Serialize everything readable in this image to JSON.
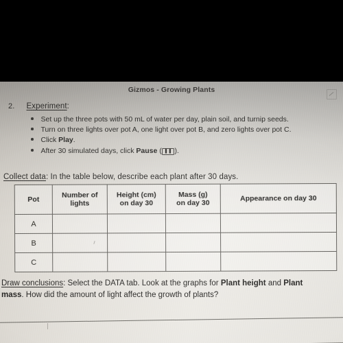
{
  "document": {
    "header_title": "Gizmos - Growing Plants",
    "header_icon": "edit-square-icon"
  },
  "section_experiment": {
    "number": "2.",
    "label": "Experiment",
    "colon": ":",
    "bullets": [
      {
        "text_before": "Set up the three pots with 50 mL of water per day, plain soil, and turnip seeds.",
        "bold": "",
        "text_after": ""
      },
      {
        "text_before": "Turn on three lights over pot A, one light over pot B, and zero lights over pot C.",
        "bold": "",
        "text_after": ""
      },
      {
        "text_before": "Click ",
        "bold": "Play",
        "text_after": "."
      },
      {
        "text_before": "After 30 simulated days, click ",
        "bold": "Pause",
        "text_after": ")."
      }
    ],
    "pause_paren_open": " (",
    "pause_icon_glyph": "❚❚",
    "pause_icon_name": "pause-icon"
  },
  "section_collect": {
    "number": "",
    "label": "Collect data",
    "rest": ": In the table below, describe each plant after 30 days."
  },
  "table": {
    "headers": [
      "Pot",
      "Number of\nlights",
      "Height (cm)\non day 30",
      "Mass (g)\non day 30",
      "Appearance on day 30"
    ],
    "header_lines": {
      "pot": "Pot",
      "lights_l1": "Number of",
      "lights_l2": "lights",
      "height_l1": "Height (cm)",
      "height_l2": "on day 30",
      "mass_l1": "Mass (g)",
      "mass_l2": "on day 30",
      "appearance": "Appearance on day 30"
    },
    "rows": [
      {
        "pot": "A",
        "lights": "",
        "height": "",
        "mass": "",
        "appearance": ""
      },
      {
        "pot": "B",
        "lights": "",
        "height": "",
        "mass": "",
        "appearance": ""
      },
      {
        "pot": "C",
        "lights": "",
        "height": "",
        "mass": "",
        "appearance": ""
      }
    ]
  },
  "section_conclusions": {
    "label": "Draw conclusions",
    "line1_a": ": Select the DATA tab. Look at the graphs for ",
    "line1_bold1": "Plant height",
    "line1_b": " and ",
    "line1_bold2": "Plant",
    "line2_bold": "mass",
    "line2_rest": ". How did the amount of light affect the growth of plants?"
  }
}
